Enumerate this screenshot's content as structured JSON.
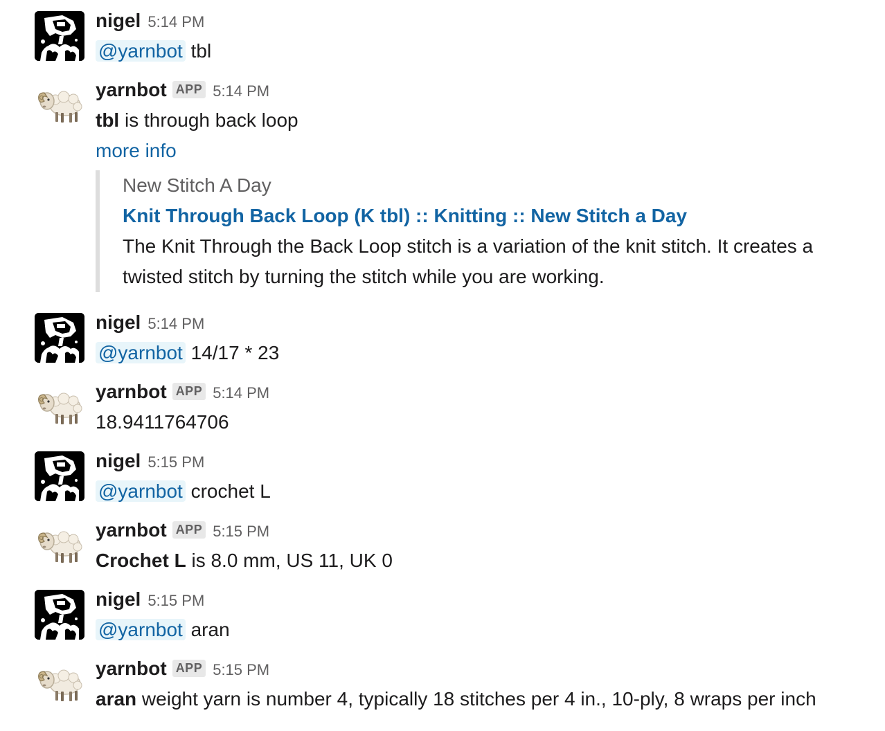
{
  "messages": [
    {
      "sender": "nigel",
      "time": "5:14 PM",
      "mention": "@yarnbot",
      "text": " tbl"
    },
    {
      "sender": "yarnbot",
      "badge": "APP",
      "time": "5:14 PM",
      "bold": "tbl",
      "text": " is through back loop",
      "link": "more info",
      "attachment": {
        "service": "New Stitch A Day",
        "title": "Knit Through Back Loop (K tbl) :: Knitting :: New Stitch a Day",
        "description_line1": "The Knit Through the Back Loop stitch is a variation of the knit stitch. It creates a",
        "description_line2": "twisted stitch by turning the stitch while you are working."
      }
    },
    {
      "sender": "nigel",
      "time": "5:14 PM",
      "mention": "@yarnbot",
      "text": " 14/17 * 23"
    },
    {
      "sender": "yarnbot",
      "badge": "APP",
      "time": "5:14 PM",
      "text": "18.9411764706"
    },
    {
      "sender": "nigel",
      "time": "5:15 PM",
      "mention": "@yarnbot",
      "text": " crochet L"
    },
    {
      "sender": "yarnbot",
      "badge": "APP",
      "time": "5:15 PM",
      "bold": "Crochet L",
      "text": " is 8.0 mm, US 11, UK 0"
    },
    {
      "sender": "nigel",
      "time": "5:15 PM",
      "mention": "@yarnbot",
      "text": " aran"
    },
    {
      "sender": "yarnbot",
      "badge": "APP",
      "time": "5:15 PM",
      "bold": "aran",
      "text": " weight yarn is number 4, typically 18 stitches per 4 in., 10-ply, 8 wraps per inch"
    }
  ],
  "colors": {
    "link": "#1264a3",
    "mention_bg": "#e8f5fa",
    "text": "#1d1c1d",
    "muted": "#616061",
    "badge_bg": "#e8e8e8",
    "attachment_bar": "#dddddd"
  },
  "icons": {
    "human_avatar": "robot-portrait-avatar-icon",
    "bot_avatar": "sheep-icon"
  }
}
